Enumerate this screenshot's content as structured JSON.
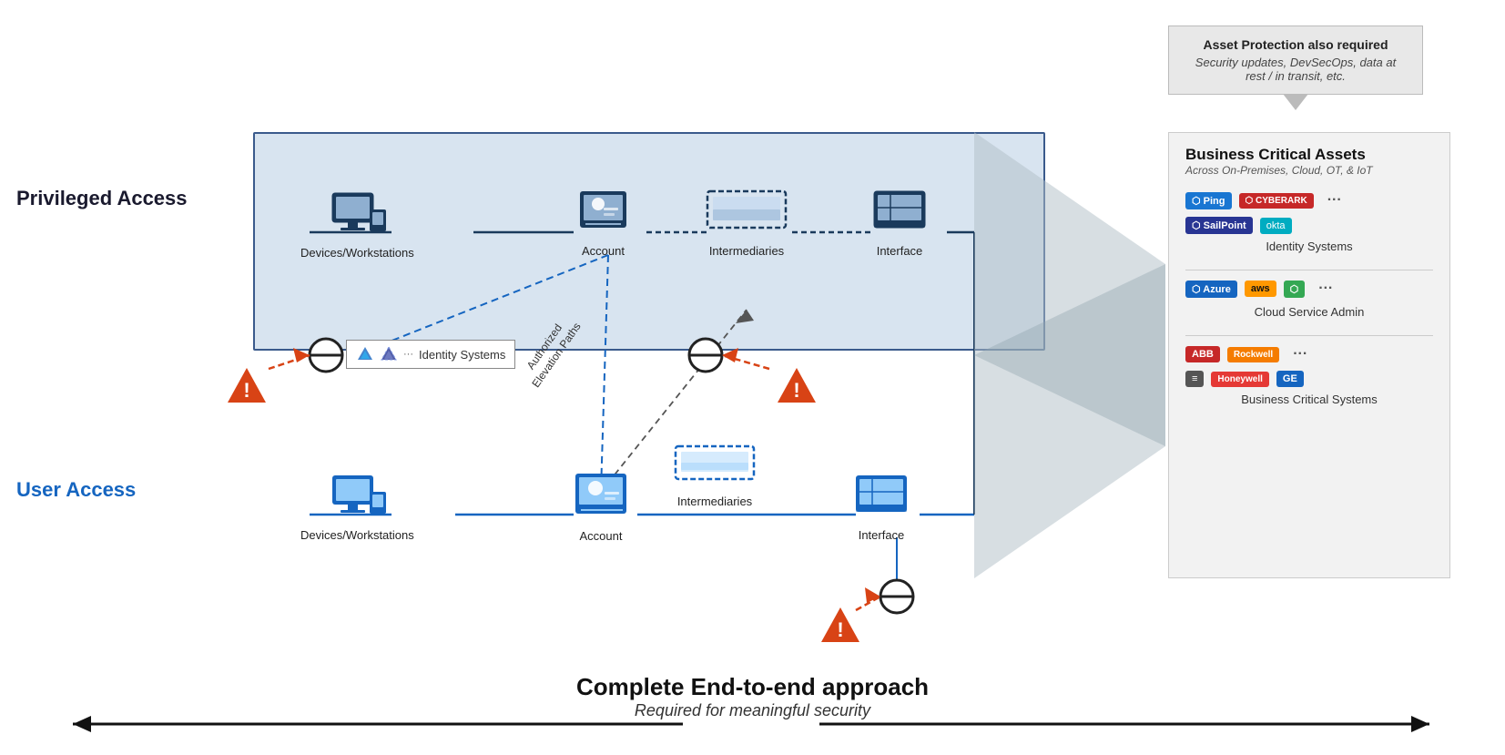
{
  "callout": {
    "title": "Asset Protection also required",
    "subtitle": "Security updates, DevSecOps, data at rest / in transit, etc."
  },
  "privileged_label": "Privileged Access",
  "user_access_label": "User Access",
  "bca": {
    "title": "Business Critical Assets",
    "subtitle": "Across On-Premises, Cloud, OT, & IoT",
    "identity_section_label": "Identity Systems",
    "cloud_section_label": "Cloud Service Admin",
    "bcs_section_label": "Business Critical Systems"
  },
  "labels": {
    "devices_workstations": "Devices/Workstations",
    "account": "Account",
    "intermediaries": "Intermediaries",
    "interface": "Interface",
    "identity_systems": "Identity Systems",
    "authorized_elevation": "Authorized\nElevation Paths",
    "complete_end_to_end": "Complete End-to-end approach",
    "required_meaningful": "Required for meaningful security"
  }
}
